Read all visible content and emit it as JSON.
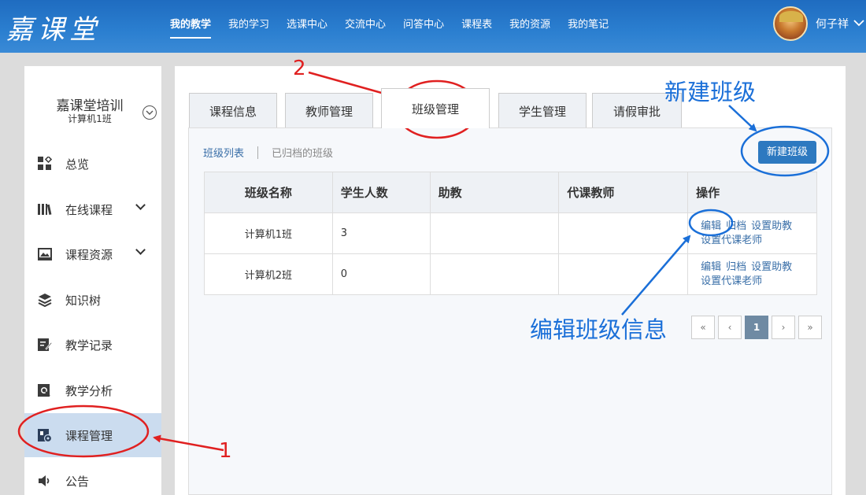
{
  "app": {
    "logo": "嘉课堂"
  },
  "nav": {
    "items": [
      "我的教学",
      "我的学习",
      "选课中心",
      "交流中心",
      "问答中心",
      "课程表",
      "我的资源",
      "我的笔记"
    ],
    "active_index": 0
  },
  "user": {
    "name": "何子祥",
    "chevron": "chevron-down-icon"
  },
  "sidebar": {
    "course_title": "嘉课堂培训",
    "class_name": "计算机1班",
    "toggle_icon": "circle-chevron-down-icon",
    "items": [
      {
        "label": "总览",
        "icon": "grid-icon"
      },
      {
        "label": "在线课程",
        "icon": "books-icon",
        "has_arrow": true
      },
      {
        "label": "课程资源",
        "icon": "image-icon",
        "has_arrow": true
      },
      {
        "label": "知识树",
        "icon": "layers-icon"
      },
      {
        "label": "教学记录",
        "icon": "edit-note-icon"
      },
      {
        "label": "教学分析",
        "icon": "analysis-icon"
      },
      {
        "label": "课程管理",
        "icon": "course-manage-icon",
        "active": true
      },
      {
        "label": "公告",
        "icon": "speaker-icon"
      }
    ]
  },
  "tabs": [
    "课程信息",
    "教师管理",
    "班级管理",
    "学生管理",
    "请假审批"
  ],
  "active_tab": 2,
  "subnav": {
    "list": "班级列表",
    "archived": "已归档的班级"
  },
  "new_class_button": "新建班级",
  "table": {
    "headers": [
      "班级名称",
      "学生人数",
      "助教",
      "代课教师",
      "操作"
    ],
    "rows": [
      {
        "name": "计算机1班",
        "students": "3",
        "assistant": "",
        "substitute": "",
        "ops": [
          "编辑",
          "归档",
          "设置助教",
          "设置代课老师"
        ]
      },
      {
        "name": "计算机2班",
        "students": "0",
        "assistant": "",
        "substitute": "",
        "ops": [
          "编辑",
          "归档",
          "设置助教",
          "设置代课老师"
        ]
      }
    ]
  },
  "pager": {
    "first": "«",
    "prev": "‹",
    "current": "1",
    "next": "›",
    "last": "»"
  },
  "annotations": {
    "num1": "1",
    "num2": "2",
    "new_class": "新建班级",
    "edit_class": "编辑班级信息",
    "red": "#e02020",
    "blue": "#1a6fd8"
  },
  "colors": {
    "topbar": "#2b7fd0",
    "accent": "#2d79c0",
    "active_menu": "#cbdcef",
    "link": "#3a6fa8"
  }
}
